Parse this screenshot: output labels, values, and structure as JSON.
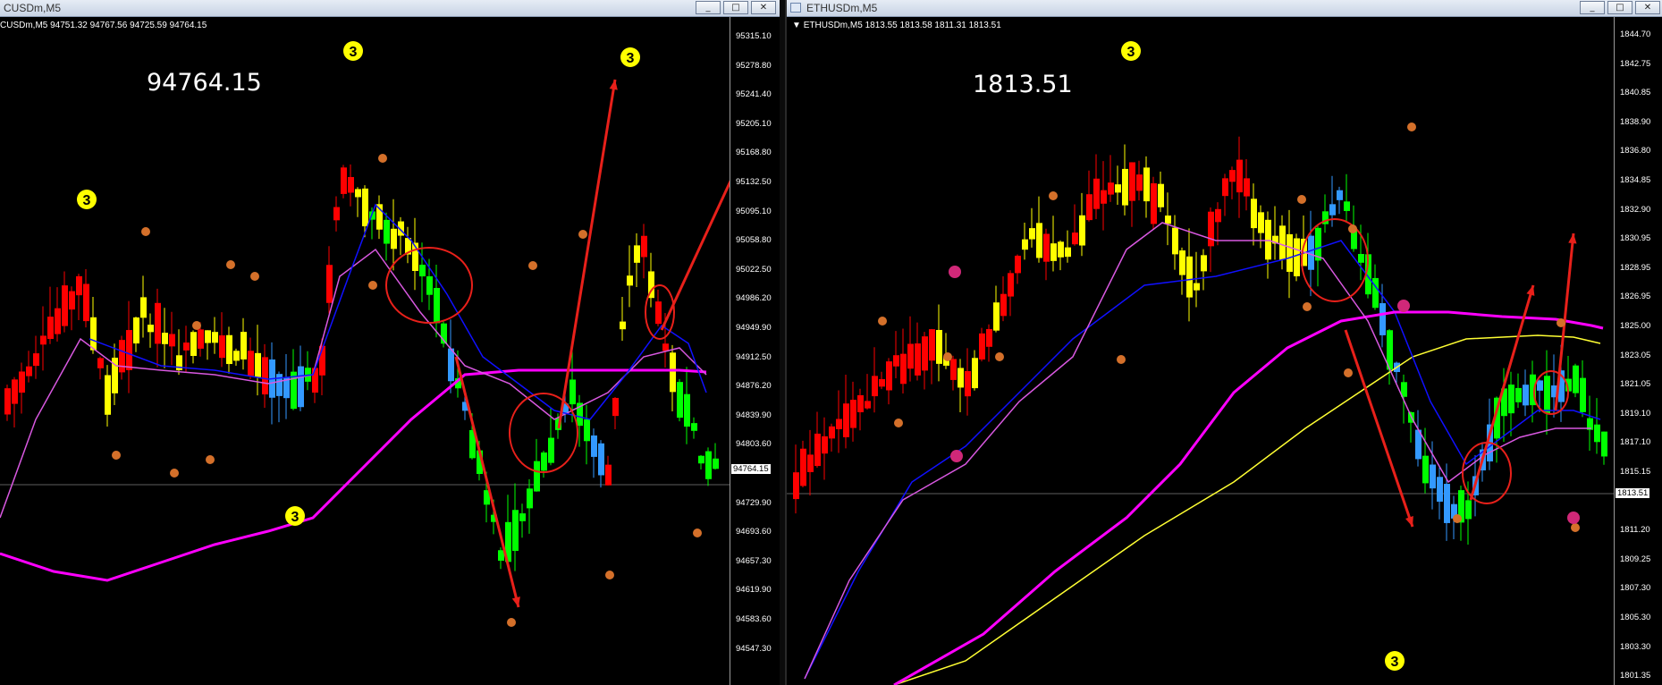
{
  "left_window": {
    "title": "CUSDm,M5",
    "info_line": "CUSDm,M5  94751.32 94767.56 94725.59 94764.15",
    "big_price": "94764.15",
    "current_label": "94764.15",
    "y_ticks": [
      "95315.10",
      "95278.80",
      "95241.40",
      "95205.10",
      "95168.80",
      "95132.50",
      "95095.10",
      "95058.80",
      "95022.50",
      "94986.20",
      "94949.90",
      "94912.50",
      "94876.20",
      "94839.90",
      "94803.60",
      "94764.15",
      "94729.90",
      "94693.60",
      "94657.30",
      "94619.90",
      "94583.60",
      "94547.30"
    ],
    "markers": [
      "3",
      "3",
      "3",
      "3"
    ]
  },
  "right_window": {
    "title": "ETHUSDm,M5",
    "info_line": "ETHUSDm,M5  1813.55 1813.58 1811.31 1813.51",
    "big_price": "1813.51",
    "current_label": "1813.51",
    "y_ticks": [
      "1844.70",
      "1842.75",
      "1840.85",
      "1838.90",
      "1836.80",
      "1834.85",
      "1832.90",
      "1830.95",
      "1828.95",
      "1826.95",
      "1825.00",
      "1823.05",
      "1821.05",
      "1819.10",
      "1817.10",
      "1815.15",
      "1813.51",
      "1811.20",
      "1809.25",
      "1807.30",
      "1805.30",
      "1803.30",
      "1801.35"
    ],
    "markers": [
      "3",
      "3"
    ]
  },
  "window_buttons": [
    "_",
    "□",
    "✕"
  ],
  "colors": {
    "bull_strong": "#ff0000",
    "bull_weak": "#ffff00",
    "bear_strong": "#00ff00",
    "bear_weak": "#3399ff",
    "ma_slow": "#ff00ff",
    "ma_fast": "#1010ff",
    "ma_yellow": "#ffff33",
    "annotation": "#e8201a"
  }
}
